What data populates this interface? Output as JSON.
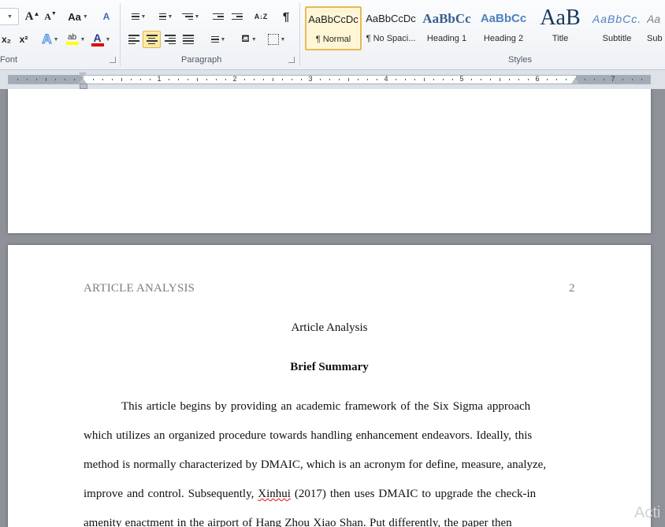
{
  "ribbon": {
    "groups": {
      "font": "Font",
      "paragraph": "Paragraph",
      "styles": "Styles"
    },
    "font_buttons": {
      "grow": "A",
      "shrink": "A",
      "change_case": "Aa",
      "clear_format": "A",
      "subscript": "x₂",
      "superscript": "x²",
      "text_effects": "A",
      "highlight": "ab",
      "font_color": "A"
    },
    "paragraph_buttons": {
      "sort": "A↓Z",
      "pilcrow": "¶"
    },
    "styles_gallery": [
      {
        "sample": "AaBbCcDc",
        "name": "¶ Normal"
      },
      {
        "sample": "AaBbCcDc",
        "name": "¶ No Spaci..."
      },
      {
        "sample": "AaBbCc",
        "name": "Heading 1"
      },
      {
        "sample": "AaBbCc",
        "name": "Heading 2"
      },
      {
        "sample": "AaB",
        "name": "Title"
      },
      {
        "sample": "AaBbCc.",
        "name": "Subtitle"
      },
      {
        "sample": "Aa",
        "name": "Sub"
      }
    ],
    "colors": {
      "highlight": "#ffff00",
      "font_color": "#e00000",
      "selected_border": "#e6b957"
    }
  },
  "ruler": {
    "numbers": [
      "1",
      "2",
      "3",
      "4",
      "5",
      "6",
      "7"
    ]
  },
  "document": {
    "header_left": "ARTICLE ANALYSIS",
    "header_right": "2",
    "title": "Article Analysis",
    "heading": "Brief Summary",
    "paragraph_lines": [
      "This article begins by providing an academic framework of the Six Sigma approach",
      "which utilizes an organized procedure towards handling enhancement endeavors. Ideally, this",
      "method is normally characterized by DMAIC, which is an acronym for define, measure, analyze,",
      "improve and control. Subsequently, Xinhui (2017) then uses DMAIC to upgrade the check-in",
      "amenity enactment in the airport of Hang Zhou Xiao Shan. Put differently, the paper then"
    ]
  },
  "overlay": {
    "watermark": "Acti"
  }
}
